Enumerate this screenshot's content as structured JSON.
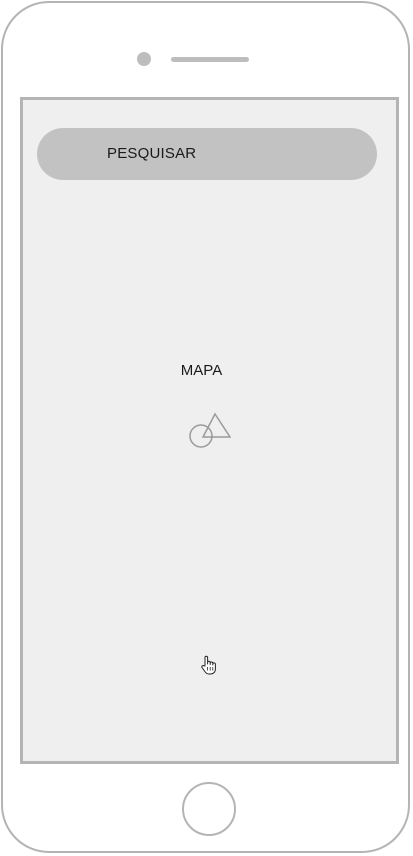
{
  "search": {
    "label": "PESQUISAR"
  },
  "map": {
    "label": "MAPA",
    "icon": "shapes-placeholder-icon"
  },
  "cursor": {
    "icon": "hand-pointer-icon"
  },
  "device": {
    "frame_color": "#b4b4b4",
    "screen_background": "#efefef",
    "search_bar_color": "#c2c2c2"
  }
}
